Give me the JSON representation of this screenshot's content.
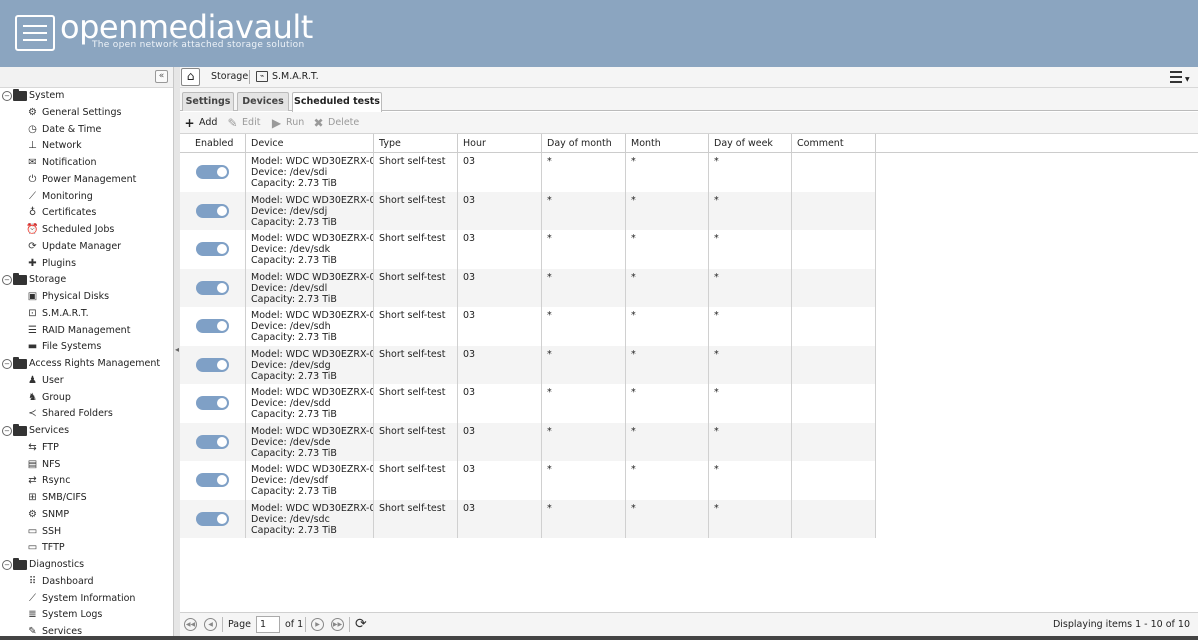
{
  "header": {
    "logo": "openmediavault",
    "tagline": "The open network attached storage solution"
  },
  "sidebar": {
    "collapse_icon": "double-chevron-left-icon",
    "items": [
      {
        "type": "group",
        "label": "System",
        "icon": "folder-icon"
      },
      {
        "type": "child",
        "label": "General Settings",
        "icon": "gears-icon",
        "glyph": "⚙"
      },
      {
        "type": "child",
        "label": "Date & Time",
        "icon": "clock-icon",
        "glyph": "◷"
      },
      {
        "type": "child",
        "label": "Network",
        "icon": "network-icon",
        "glyph": "⊥"
      },
      {
        "type": "child",
        "label": "Notification",
        "icon": "envelope-icon",
        "glyph": "✉"
      },
      {
        "type": "child",
        "label": "Power Management",
        "icon": "power-icon",
        "glyph": "⏻"
      },
      {
        "type": "child",
        "label": "Monitoring",
        "icon": "chart-line-icon",
        "glyph": "⟋"
      },
      {
        "type": "child",
        "label": "Certificates",
        "icon": "certificate-icon",
        "glyph": "♁"
      },
      {
        "type": "child",
        "label": "Scheduled Jobs",
        "icon": "alarm-clock-icon",
        "glyph": "⏰"
      },
      {
        "type": "child",
        "label": "Update Manager",
        "icon": "update-icon",
        "glyph": "⟳"
      },
      {
        "type": "child",
        "label": "Plugins",
        "icon": "puzzle-icon",
        "glyph": "✚"
      },
      {
        "type": "group",
        "label": "Storage",
        "icon": "folder-icon"
      },
      {
        "type": "child",
        "label": "Physical Disks",
        "icon": "disk-icon",
        "glyph": "▣"
      },
      {
        "type": "child",
        "label": "S.M.A.R.T.",
        "icon": "smart-icon",
        "glyph": "⊡"
      },
      {
        "type": "child",
        "label": "RAID Management",
        "icon": "raid-icon",
        "glyph": "☰"
      },
      {
        "type": "child",
        "label": "File Systems",
        "icon": "filesystem-folder-icon",
        "glyph": "▬"
      },
      {
        "type": "group",
        "label": "Access Rights Management",
        "icon": "folder-icon"
      },
      {
        "type": "child",
        "label": "User",
        "icon": "user-icon",
        "glyph": "♟"
      },
      {
        "type": "child",
        "label": "Group",
        "icon": "users-icon",
        "glyph": "♞"
      },
      {
        "type": "child",
        "label": "Shared Folders",
        "icon": "share-icon",
        "glyph": "≺"
      },
      {
        "type": "group",
        "label": "Services",
        "icon": "folder-icon"
      },
      {
        "type": "child",
        "label": "FTP",
        "icon": "ftp-icon",
        "glyph": "⇆"
      },
      {
        "type": "child",
        "label": "NFS",
        "icon": "nfs-icon",
        "glyph": "▤"
      },
      {
        "type": "child",
        "label": "Rsync",
        "icon": "rsync-icon",
        "glyph": "⇄"
      },
      {
        "type": "child",
        "label": "SMB/CIFS",
        "icon": "windows-icon",
        "glyph": "⊞"
      },
      {
        "type": "child",
        "label": "SNMP",
        "icon": "snmp-icon",
        "glyph": "⚙"
      },
      {
        "type": "child",
        "label": "SSH",
        "icon": "terminal-icon",
        "glyph": "▭"
      },
      {
        "type": "child",
        "label": "TFTP",
        "icon": "monitor-icon",
        "glyph": "▭"
      },
      {
        "type": "group",
        "label": "Diagnostics",
        "icon": "folder-icon"
      },
      {
        "type": "child",
        "label": "Dashboard",
        "icon": "dashboard-grid-icon",
        "glyph": "⠿"
      },
      {
        "type": "child",
        "label": "System Information",
        "icon": "chart-line-icon",
        "glyph": "⟋"
      },
      {
        "type": "child",
        "label": "System Logs",
        "icon": "logs-icon",
        "glyph": "≣"
      },
      {
        "type": "child",
        "label": "Services",
        "icon": "wrench-icon",
        "glyph": "✎"
      }
    ]
  },
  "breadcrumb": {
    "home_icon": "home-icon",
    "storage": "Storage",
    "current": "S.M.A.R.T."
  },
  "tabs": [
    {
      "label": "Settings",
      "active": false
    },
    {
      "label": "Devices",
      "active": false
    },
    {
      "label": "Scheduled tests",
      "active": true
    }
  ],
  "toolbar": {
    "add": "Add",
    "edit": "Edit",
    "run": "Run",
    "delete": "Delete"
  },
  "grid": {
    "columns": [
      "Enabled",
      "Device",
      "Type",
      "Hour",
      "Day of month",
      "Month",
      "Day of week",
      "Comment"
    ],
    "rows": [
      {
        "enabled": true,
        "model": "Model: WDC WD30EZRX-0...",
        "device": "Device: /dev/sdi",
        "capacity": "Capacity: 2.73 TiB",
        "type": "Short self-test",
        "hour": "03",
        "dom": "*",
        "month": "*",
        "dow": "*",
        "comment": ""
      },
      {
        "enabled": true,
        "model": "Model: WDC WD30EZRX-0...",
        "device": "Device: /dev/sdj",
        "capacity": "Capacity: 2.73 TiB",
        "type": "Short self-test",
        "hour": "03",
        "dom": "*",
        "month": "*",
        "dow": "*",
        "comment": ""
      },
      {
        "enabled": true,
        "model": "Model: WDC WD30EZRX-0...",
        "device": "Device: /dev/sdk",
        "capacity": "Capacity: 2.73 TiB",
        "type": "Short self-test",
        "hour": "03",
        "dom": "*",
        "month": "*",
        "dow": "*",
        "comment": ""
      },
      {
        "enabled": true,
        "model": "Model: WDC WD30EZRX-0...",
        "device": "Device: /dev/sdl",
        "capacity": "Capacity: 2.73 TiB",
        "type": "Short self-test",
        "hour": "03",
        "dom": "*",
        "month": "*",
        "dow": "*",
        "comment": ""
      },
      {
        "enabled": true,
        "model": "Model: WDC WD30EZRX-0...",
        "device": "Device: /dev/sdh",
        "capacity": "Capacity: 2.73 TiB",
        "type": "Short self-test",
        "hour": "03",
        "dom": "*",
        "month": "*",
        "dow": "*",
        "comment": ""
      },
      {
        "enabled": true,
        "model": "Model: WDC WD30EZRX-0...",
        "device": "Device: /dev/sdg",
        "capacity": "Capacity: 2.73 TiB",
        "type": "Short self-test",
        "hour": "03",
        "dom": "*",
        "month": "*",
        "dow": "*",
        "comment": ""
      },
      {
        "enabled": true,
        "model": "Model: WDC WD30EZRX-0...",
        "device": "Device: /dev/sdd",
        "capacity": "Capacity: 2.73 TiB",
        "type": "Short self-test",
        "hour": "03",
        "dom": "*",
        "month": "*",
        "dow": "*",
        "comment": ""
      },
      {
        "enabled": true,
        "model": "Model: WDC WD30EZRX-0...",
        "device": "Device: /dev/sde",
        "capacity": "Capacity: 2.73 TiB",
        "type": "Short self-test",
        "hour": "03",
        "dom": "*",
        "month": "*",
        "dow": "*",
        "comment": ""
      },
      {
        "enabled": true,
        "model": "Model: WDC WD30EZRX-0...",
        "device": "Device: /dev/sdf",
        "capacity": "Capacity: 2.73 TiB",
        "type": "Short self-test",
        "hour": "03",
        "dom": "*",
        "month": "*",
        "dow": "*",
        "comment": ""
      },
      {
        "enabled": true,
        "model": "Model: WDC WD30EZRX-0...",
        "device": "Device: /dev/sdc",
        "capacity": "Capacity: 2.73 TiB",
        "type": "Short self-test",
        "hour": "03",
        "dom": "*",
        "month": "*",
        "dow": "*",
        "comment": ""
      }
    ]
  },
  "pager": {
    "page_label": "Page",
    "page_value": "1",
    "of_label": "of 1",
    "status": "Displaying items 1 - 10 of 10"
  },
  "colors": {
    "header_bg": "#8ba5c0",
    "toggle_on": "#7fa0c6"
  }
}
